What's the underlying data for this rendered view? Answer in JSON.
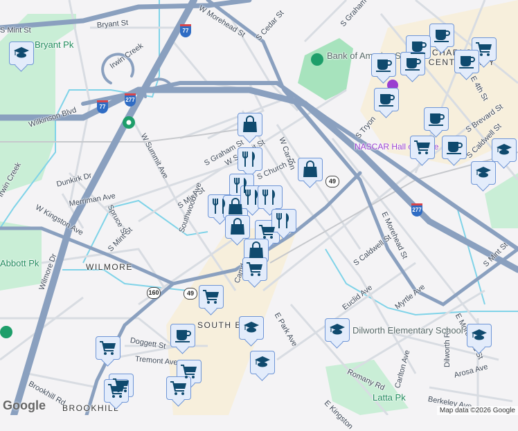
{
  "streets": [
    "Bryant St",
    "W Morehead St",
    "S Cedar St",
    "S Graham St",
    "Wilkinson Blvd",
    "W Summit Ave",
    "S Graham St",
    "S Mint St",
    "Dunkirk Dr",
    "W Kingston Ave",
    "Merriman Ave",
    "Spruce St",
    "S Mint St",
    "Southwood Ave",
    "S Mint St",
    "W Carson",
    "S Church St",
    "S Tryon",
    "E 4th St",
    "S Brevard St",
    "S Caldwell St",
    "E Morehead St",
    "S Caldwell St",
    "Myrtle Ave",
    "E Park Ave",
    "Euclid Ave",
    "Wilmore Dr",
    "Doggett St",
    "Tremont Ave",
    "Brookhill Rd",
    "Camden",
    "Romany Rd",
    "Carlton Ave",
    "Dilworth Rd",
    "Arosa Ave",
    "Berkeley Ave",
    "E Kingston",
    "E Morehead St",
    "S Mint St",
    "Irwin Creek",
    "Irwin Creek",
    "W Summit St"
  ],
  "parks": [
    "Bryant Pk",
    "Abbott Pk",
    "Latta Pk"
  ],
  "areas": [
    "WILMORE",
    "SOUTH END",
    "BROOKHILL",
    "CHARLOTTE CENTER CITY"
  ],
  "pois": [
    "Bank of America Stadium",
    "NASCAR Hall of Fame",
    "Dilworth Elementary School"
  ],
  "shields": [
    "77",
    "277",
    "77",
    "277",
    "49",
    "49",
    "160"
  ],
  "markers": [
    "school",
    "coffee",
    "coffee",
    "coffee",
    "coffee",
    "cart",
    "coffee",
    "coffee",
    "coffee",
    "cart",
    "coffee",
    "school",
    "school",
    "bag",
    "food",
    "food",
    "food",
    "bag",
    "food",
    "bag",
    "food",
    "cart",
    "food",
    "bag",
    "bag",
    "cart",
    "cart",
    "school",
    "coffee",
    "school",
    "school",
    "school",
    "cart",
    "cart",
    "cart",
    "cart",
    "cart"
  ],
  "footer": {
    "logo": "Google",
    "attribution": "Map data ©2026 Google"
  },
  "colors": {
    "highway": "#8aa0bf",
    "road": "#d3d8df",
    "park": "#c9eed6",
    "water": "#7fd3e8",
    "downtown": "#f7efdc",
    "marker": "#0f4a6e"
  }
}
